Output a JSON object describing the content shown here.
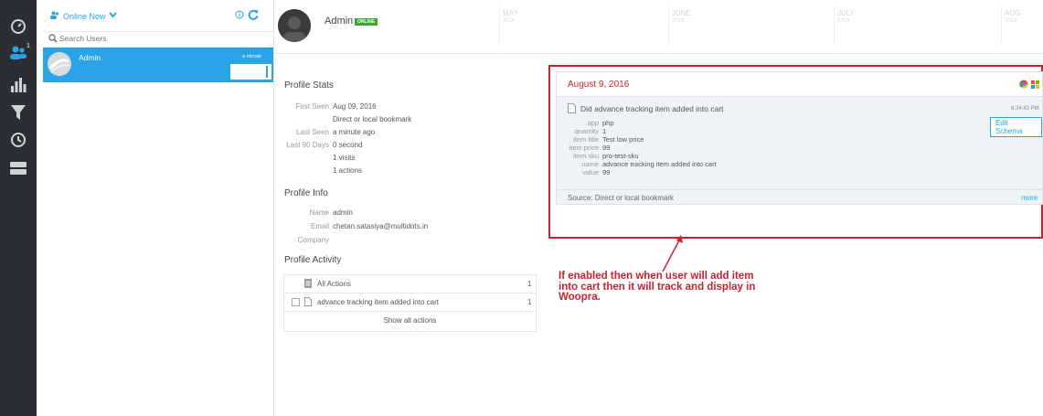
{
  "sidebar": {
    "icons": [
      "dashboard-icon",
      "people-icon",
      "bar-chart-icon",
      "funnel-icon",
      "history-icon",
      "toggle-icon"
    ],
    "people_badge": "1"
  },
  "userlist": {
    "filter_label": "Online Now",
    "search_placeholder": "Search Users",
    "users": [
      {
        "name": "Admin",
        "time": "a minute"
      }
    ]
  },
  "profile": {
    "name": "Admin",
    "status": "ONLINE"
  },
  "timeline": {
    "months": [
      {
        "name": "MAY",
        "year": "2016"
      },
      {
        "name": "JUNE",
        "year": "2016"
      },
      {
        "name": "JULY",
        "year": "2016"
      },
      {
        "name": "AUG",
        "year": "2016"
      }
    ]
  },
  "stats": {
    "title": "Profile Stats",
    "first_seen_label": "First Seen",
    "first_seen": "Aug 09, 2016",
    "referrer": "Direct or local bookmark",
    "last_seen_label": "Last Seen",
    "last_seen": "a minute ago",
    "last90_label": "Last 90 Days",
    "last90": "0 second",
    "visits": "1 visits",
    "actions": "1 actions"
  },
  "info": {
    "title": "Profile Info",
    "name_label": "Name",
    "name": "admin",
    "email_label": "Email",
    "email": "chetan.satasiya@multidots.in",
    "company_label": "Company"
  },
  "activity": {
    "title": "Profile Activity",
    "all_label": "All Actions",
    "all_count": "1",
    "item_label": "advance tracking item added into cart",
    "item_count": "1",
    "show_all": "Show all actions"
  },
  "event": {
    "date": "August 9, 2016",
    "title": "Did advance tracking item added into cart",
    "time": "6:34:43 PM",
    "edit_schema": "Edit Schema",
    "props": [
      {
        "key": "app",
        "value": "php"
      },
      {
        "key": "quantity",
        "value": "1"
      },
      {
        "key": "item title",
        "value": "Test low price"
      },
      {
        "key": "item price",
        "value": "99"
      },
      {
        "key": "item sku",
        "value": "pro-test-sku"
      },
      {
        "key": "name",
        "value": "advance tracking item added into cart"
      },
      {
        "key": "value",
        "value": "99"
      }
    ],
    "source": "Source: Direct or local bookmark",
    "more": "more"
  },
  "annotation": {
    "line1": "If enabled then when user will add item",
    "line2": "into cart then it will track and display in",
    "line3": "Woopra.",
    "color": "#c8222f"
  }
}
